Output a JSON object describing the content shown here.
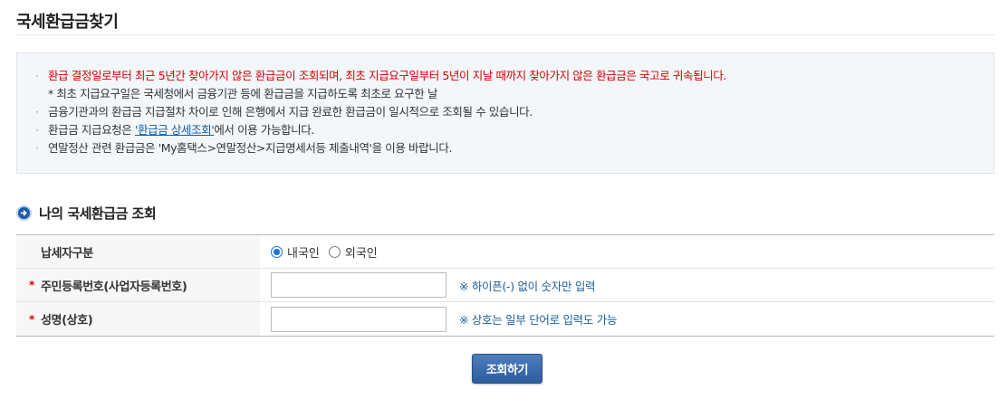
{
  "page": {
    "title": "국세환급금찾기"
  },
  "notice": {
    "line1": "환급 결정일로부터 최근 5년간 찾아가지 않은 환급금이 조회되며, 최초 지급요구일부터 5년이 지날 때까지 찾아가지 않은 환급금은 국고로 귀속됩니다.",
    "line1_sub": "* 최초 지급요구일은 국세청에서 금융기관 등에 환급금을 지급하도록 최초로 요구한 날",
    "line2": "금융기관과의 환급금 지급절차 차이로 인해 은행에서 지급 완료한 환급금이 일시적으로 조회될 수 있습니다.",
    "line3_prefix": "환급금 지급요청은 ",
    "line3_link": "'환급금 상세조회'",
    "line3_suffix": "에서 이용 가능합니다.",
    "line4": "연말정산 관련 환급금은 'My홈택스>연말정산>지급명세서등 제출내역'을 이용 바랍니다.",
    "colors": {
      "warning": "#d50000",
      "link": "#0e5fa8"
    }
  },
  "section": {
    "heading": "나의 국세환급금 조회",
    "icon": "arrow-right-circle-icon"
  },
  "form": {
    "taxpayer_type": {
      "label": "납세자구분",
      "options": [
        "내국인",
        "외국인"
      ],
      "selected": "내국인"
    },
    "id_number": {
      "required_mark": "*",
      "label": "주민등록번호(사업자등록번호)",
      "value": "",
      "hint": "※ 하이픈(-) 없이 숫자만 입력"
    },
    "name": {
      "required_mark": "*",
      "label": "성명(상호)",
      "value": "",
      "hint": "※ 상호는 일부 단어로 입력도 가능"
    }
  },
  "actions": {
    "submit_label": "조회하기"
  }
}
